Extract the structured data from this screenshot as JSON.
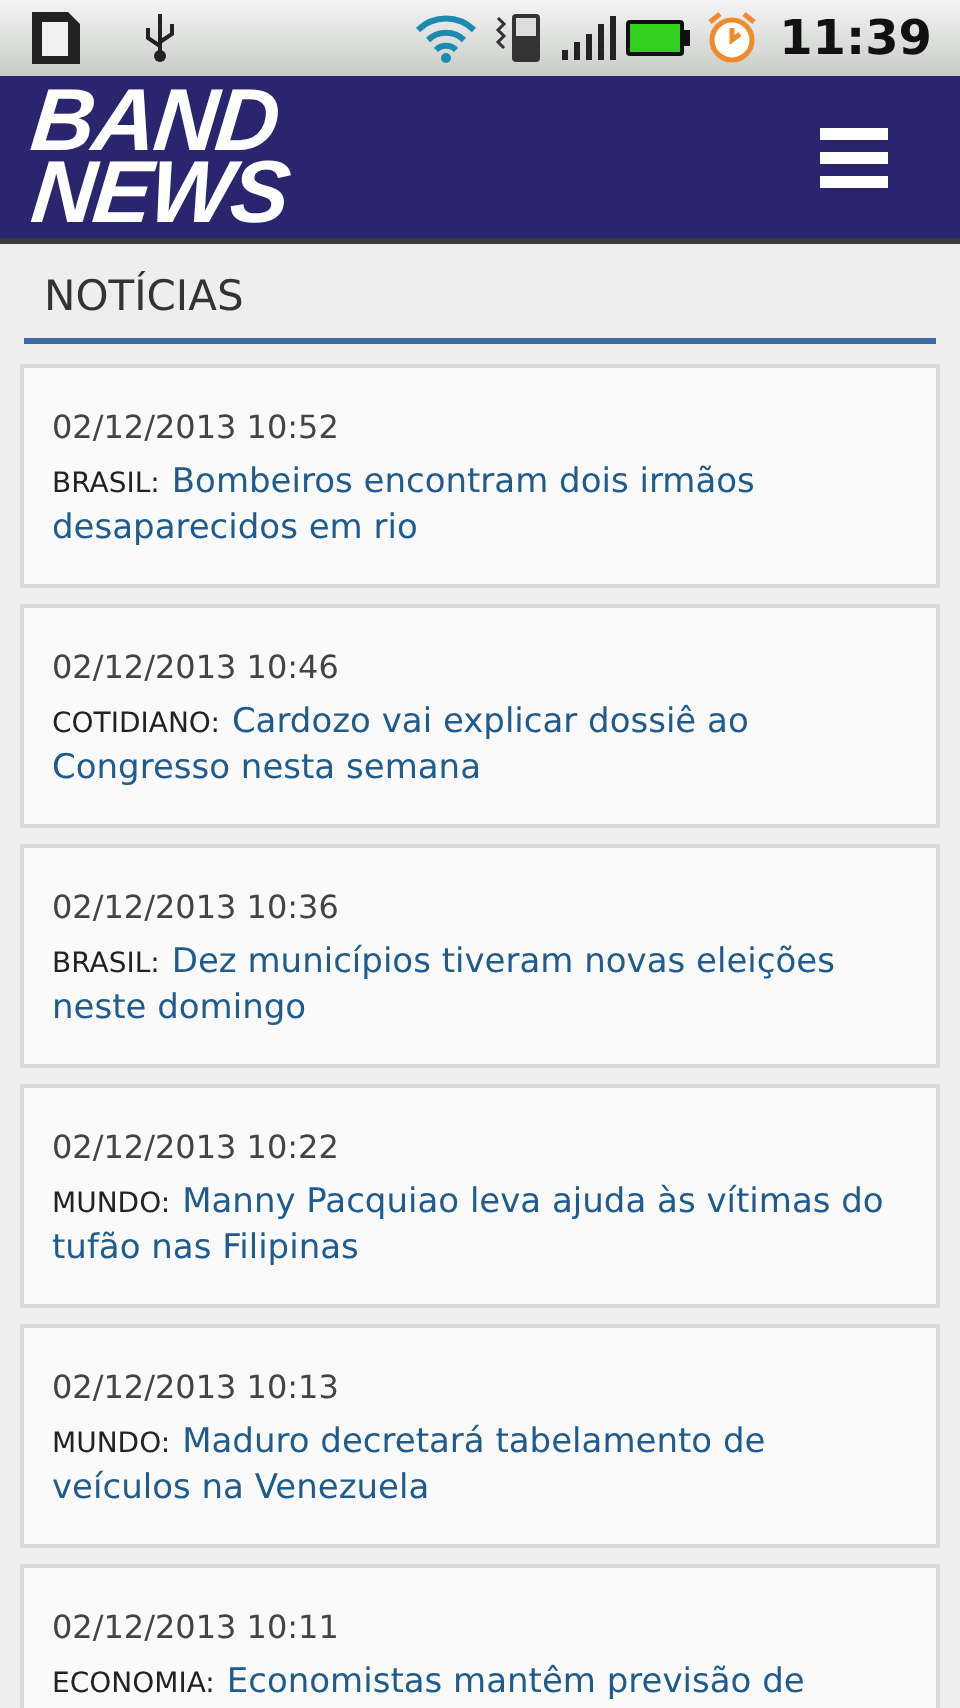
{
  "status_bar": {
    "time": "11:39"
  },
  "header": {
    "logo_line_1": "BAND",
    "logo_line_2": "NEWS"
  },
  "section": {
    "title": "NOTÍCIAS"
  },
  "news": [
    {
      "date": "02/12/2013 10:52",
      "category": "BRASIL:",
      "title": "Bombeiros encontram dois irmãos desaparecidos em rio"
    },
    {
      "date": "02/12/2013 10:46",
      "category": "COTIDIANO:",
      "title": "Cardozo vai explicar dossiê ao Congresso nesta semana"
    },
    {
      "date": "02/12/2013 10:36",
      "category": "BRASIL:",
      "title": "Dez municípios tiveram novas eleições neste domingo"
    },
    {
      "date": "02/12/2013 10:22",
      "category": "MUNDO:",
      "title": "Manny Pacquiao leva ajuda às vítimas do tufão nas Filipinas"
    },
    {
      "date": "02/12/2013 10:13",
      "category": "MUNDO:",
      "title": "Maduro decretará tabelamento de veículos na Venezuela"
    },
    {
      "date": "02/12/2013 10:11",
      "category": "ECONOMIA:",
      "title": "Economistas mantêm previsão de"
    }
  ]
}
